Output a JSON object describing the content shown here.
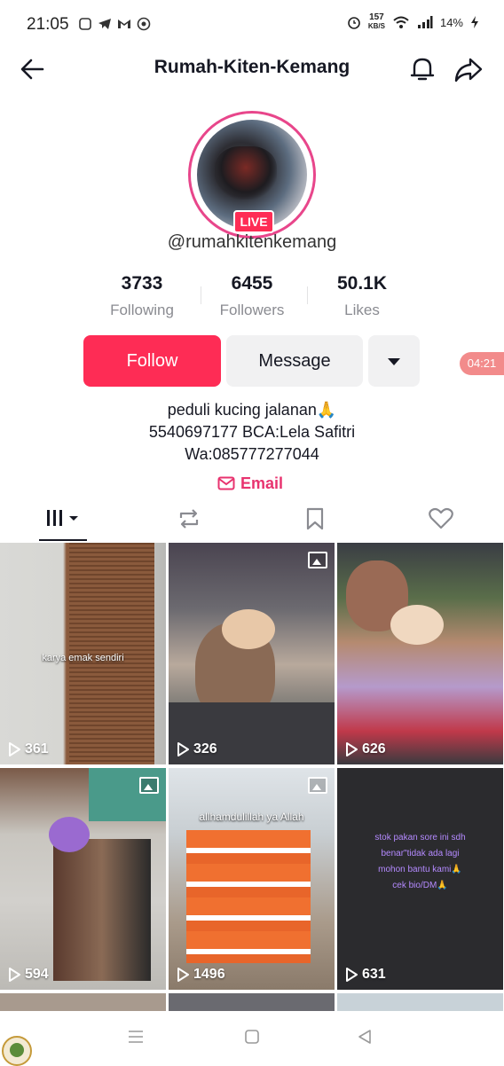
{
  "status_bar": {
    "time": "21:05",
    "speed_top": "157",
    "speed_unit": "KB/S",
    "battery": "14%"
  },
  "header": {
    "title": "Rumah-Kiten-Kemang"
  },
  "profile": {
    "live_label": "LIVE",
    "username": "@rumahkitenkemang",
    "stats": [
      {
        "value": "3733",
        "label": "Following"
      },
      {
        "value": "6455",
        "label": "Followers"
      },
      {
        "value": "50.1K",
        "label": "Likes"
      }
    ],
    "follow_label": "Follow",
    "message_label": "Message",
    "timer": "04:21",
    "bio_lines": [
      "peduli kucing jalanan🙏",
      "5540697177 BCA:Lela Safitri",
      "Wa:085777277044"
    ],
    "email_label": "Email"
  },
  "videos": [
    {
      "views": "361",
      "caption": "karya emak sendiri",
      "type": "video"
    },
    {
      "views": "326",
      "caption": "",
      "type": "photo"
    },
    {
      "views": "626",
      "caption": "",
      "type": "video"
    },
    {
      "views": "594",
      "caption": "",
      "type": "photo"
    },
    {
      "views": "1496",
      "caption": "allhamdulillah ya Allah",
      "type": "photo"
    },
    {
      "views": "631",
      "caption_lines": [
        "stok pakan sore ini sdh",
        "benar\"tidak ada lagi",
        "mohon bantu kami🙏",
        "cek bio/DM🙏"
      ],
      "type": "video"
    }
  ],
  "colors": {
    "primary": "#fe2c55",
    "live_ring": "#e8468b",
    "email": "#e8336f",
    "secondary_bg": "#f1f1f2"
  }
}
